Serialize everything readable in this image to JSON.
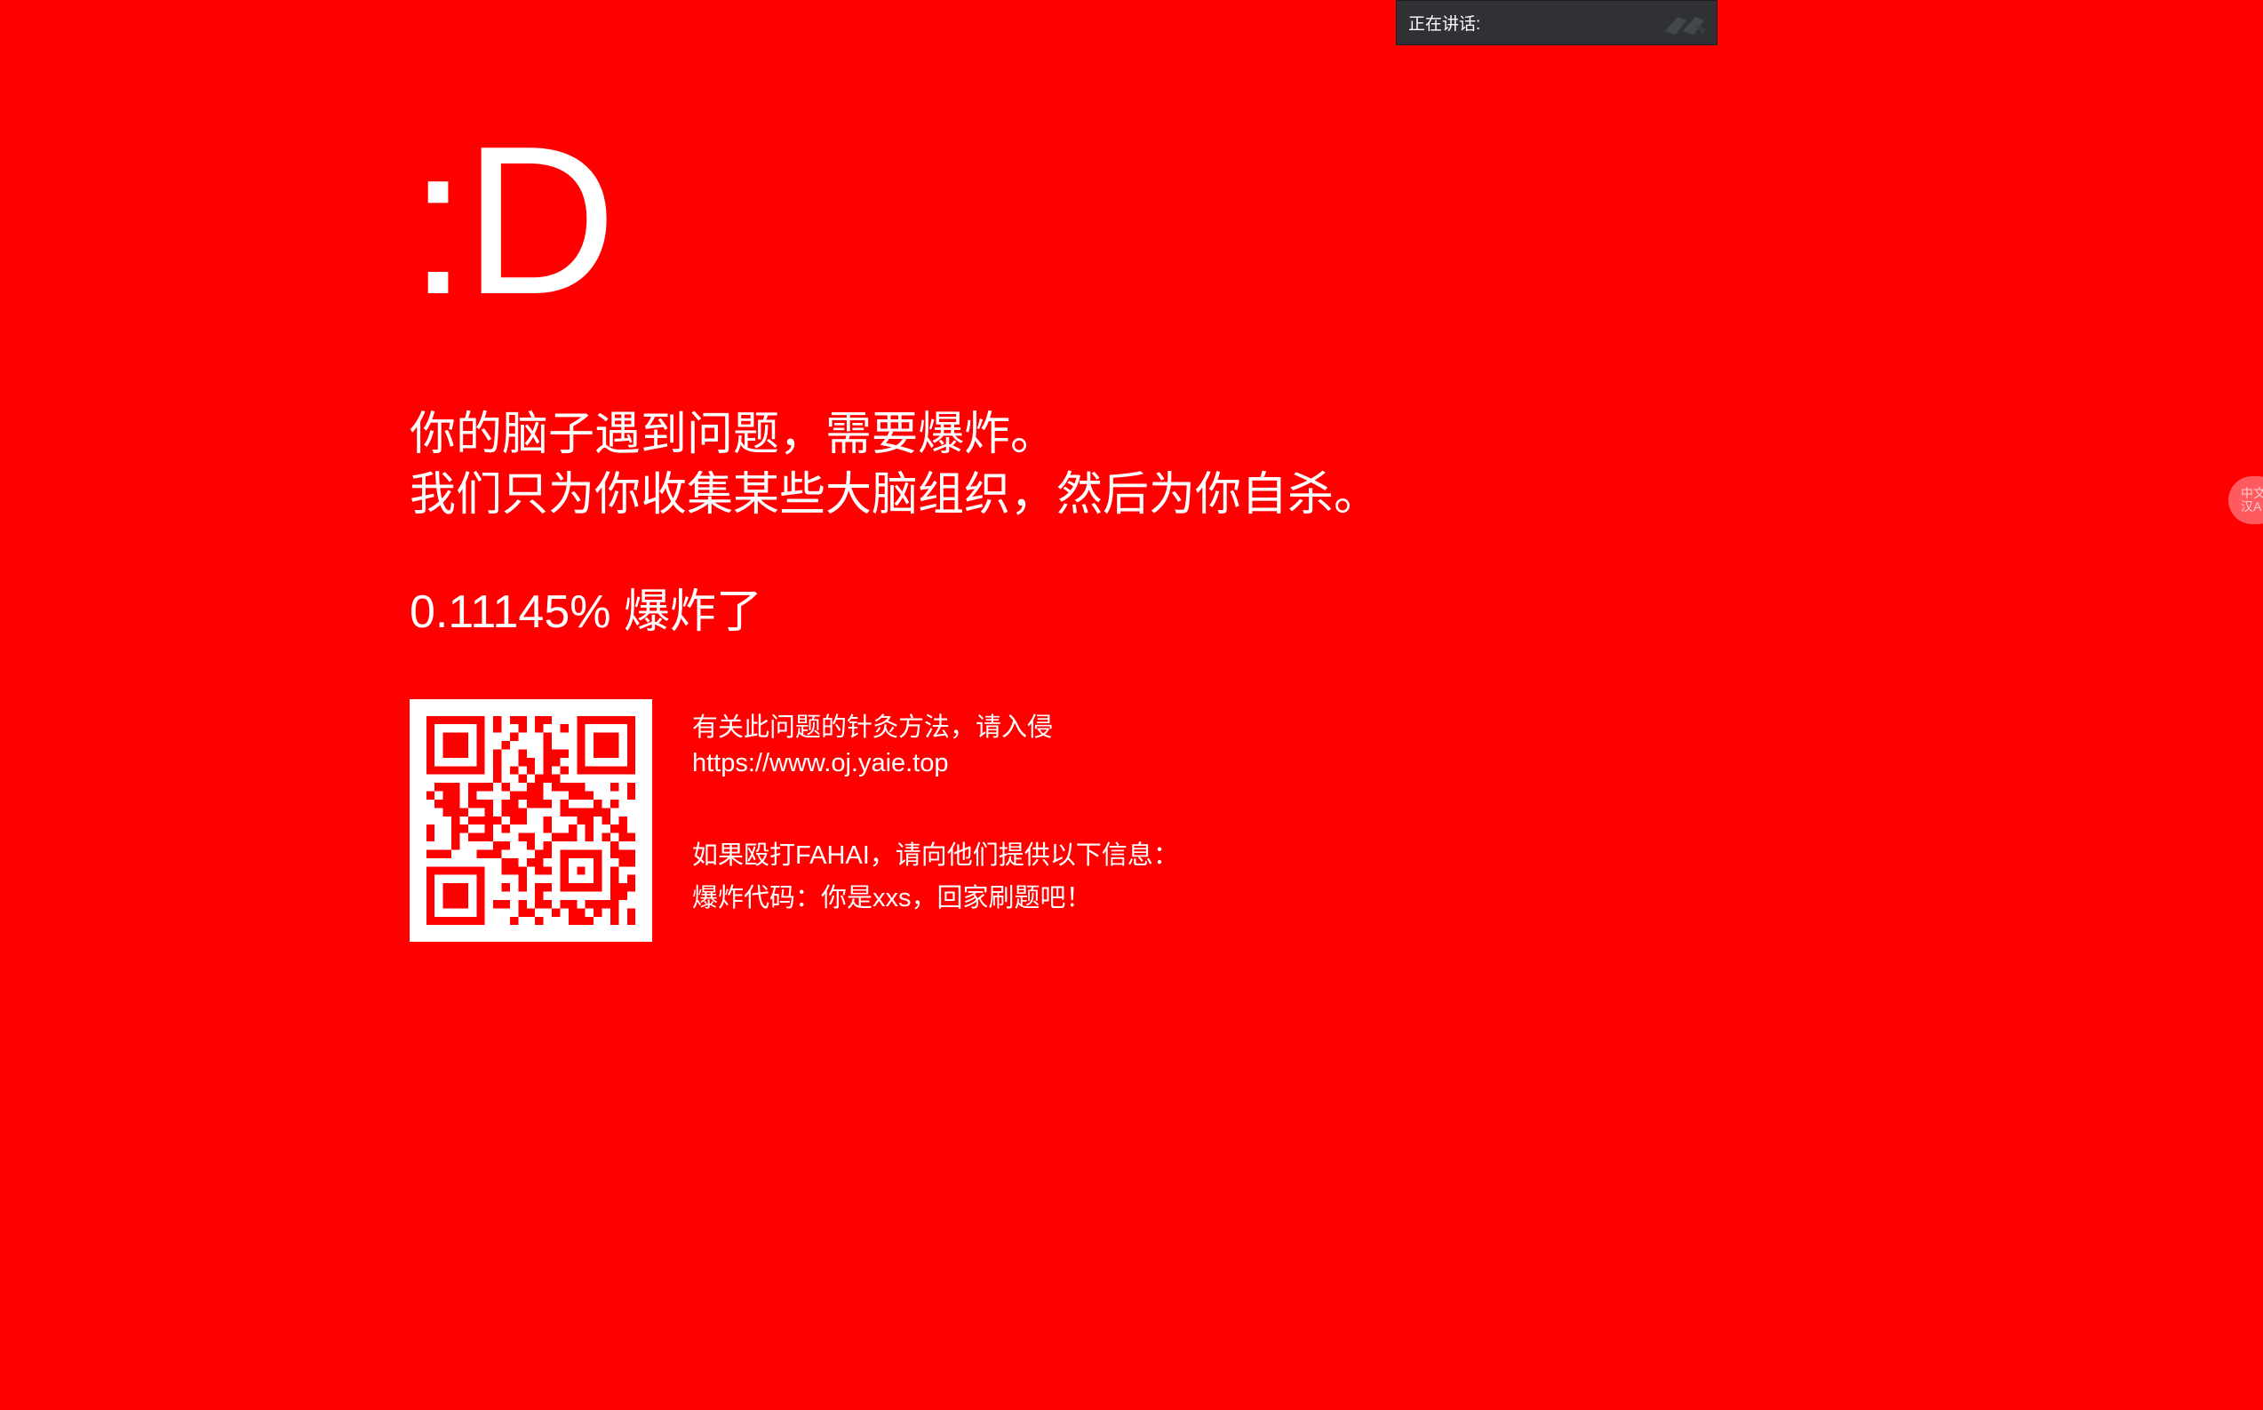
{
  "speaking_indicator": {
    "label": "正在讲话:",
    "icon": "drag-handle-icon"
  },
  "error_screen": {
    "emoticon": ":D",
    "message_line1": "你的脑子遇到问题，需要爆炸。",
    "message_line2": "我们只为你收集某些大脑组织，然后为你自杀。",
    "progress_text": "0.11145% 爆炸了",
    "info_line1": "有关此问题的针灸方法，请入侵",
    "info_url": "https://www.oj.yaie.top",
    "info_line3": "如果殴打FAHAI，请向他们提供以下信息：",
    "info_line4": "爆炸代码：你是xxs，回家刷题吧！"
  },
  "side_widget": {
    "label": "中文\n汉A",
    "icon": "language-bubble-icon"
  },
  "colors": {
    "background": "#fe0000",
    "text": "#ffffff",
    "speaking_bar": "#2f3134",
    "side_bubble": "#fe5a5f"
  }
}
